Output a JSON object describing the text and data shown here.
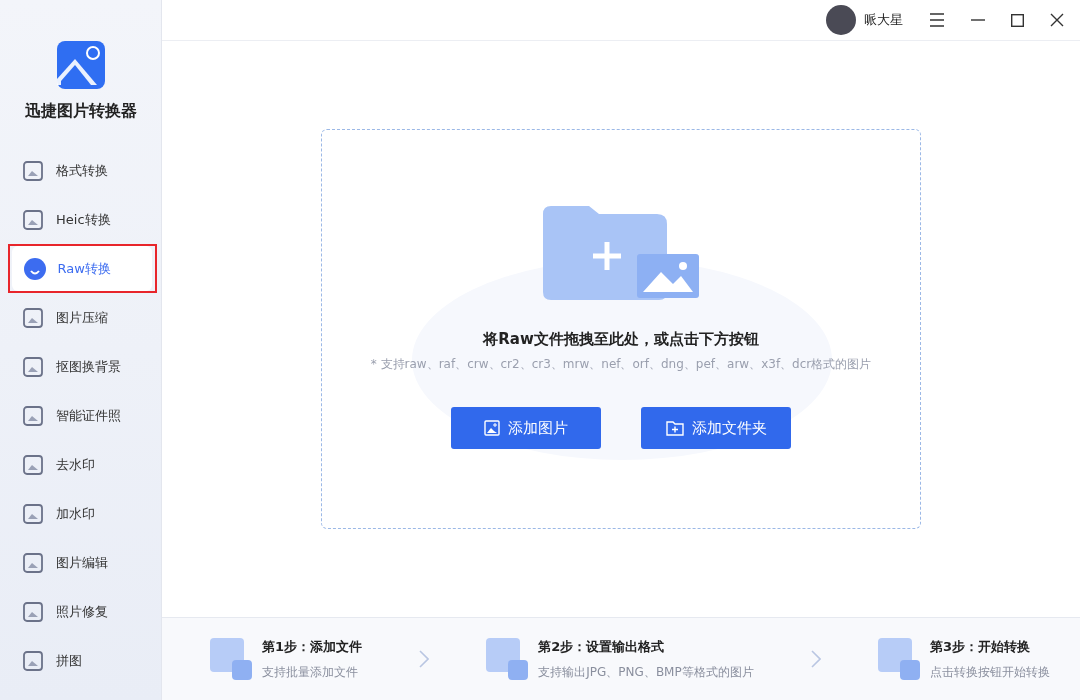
{
  "app": {
    "name": "迅捷图片转换器"
  },
  "sidebar": {
    "items": [
      {
        "label": "格式转换",
        "selected": false
      },
      {
        "label": "Heic转换",
        "selected": false
      },
      {
        "label": "Raw转换",
        "selected": true
      },
      {
        "label": "图片压缩",
        "selected": false
      },
      {
        "label": "抠图换背景",
        "selected": false
      },
      {
        "label": "智能证件照",
        "selected": false
      },
      {
        "label": "去水印",
        "selected": false
      },
      {
        "label": "加水印",
        "selected": false
      },
      {
        "label": "图片编辑",
        "selected": false
      },
      {
        "label": "照片修复",
        "selected": false
      },
      {
        "label": "拼图",
        "selected": false
      }
    ]
  },
  "user": {
    "name": "哌大星"
  },
  "dropzone": {
    "title": "将Raw文件拖拽至此处，或点击下方按钮",
    "hint": "* 支持raw、raf、crw、cr2、cr3、mrw、nef、orf、dng、pef、arw、x3f、dcr格式的图片",
    "buttons": [
      {
        "label": "添加图片",
        "kind": "image"
      },
      {
        "label": "添加文件夹",
        "kind": "folder"
      }
    ]
  },
  "steps": [
    {
      "title": "第1步：添加文件",
      "desc": "支持批量添加文件"
    },
    {
      "title": "第2步：设置输出格式",
      "desc": "支持输出JPG、PNG、BMP等格式的图片"
    },
    {
      "title": "第3步：开始转换",
      "desc": "点击转换按钮开始转换"
    }
  ]
}
